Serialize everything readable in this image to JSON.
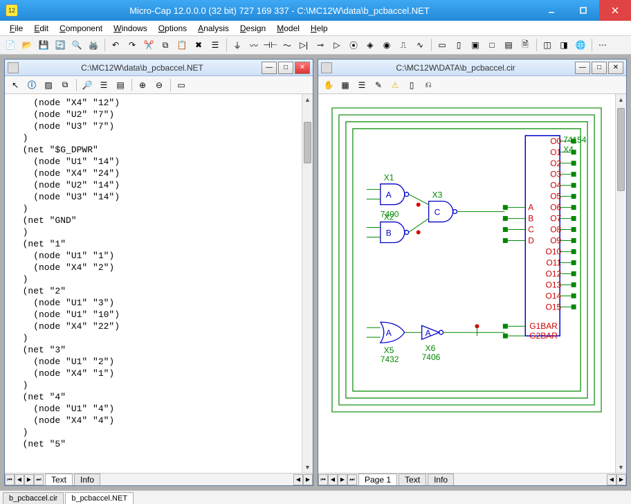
{
  "app": {
    "title": "Micro-Cap 12.0.0.0 (32 bit) 727 169 337 - C:\\MC12W\\data\\b_pcbaccel.NET",
    "icon_text": "12"
  },
  "menus": [
    "File",
    "Edit",
    "Component",
    "Windows",
    "Options",
    "Analysis",
    "Design",
    "Model",
    "Help"
  ],
  "bottom_tabs": [
    "b_pcbaccel.cir",
    "b_pcbaccel.NET"
  ],
  "left_panel": {
    "title": "C:\\MC12W\\data\\b_pcbaccel.NET",
    "tabs": [
      "Text",
      "Info"
    ],
    "content": "    (node \"X4\" \"12\")\n    (node \"U2\" \"7\")\n    (node \"U3\" \"7\")\n  )\n  (net \"$G_DPWR\"\n    (node \"U1\" \"14\")\n    (node \"X4\" \"24\")\n    (node \"U2\" \"14\")\n    (node \"U3\" \"14\")\n  )\n  (net \"GND\"\n  )\n  (net \"1\"\n    (node \"U1\" \"1\")\n    (node \"X4\" \"2\")\n  )\n  (net \"2\"\n    (node \"U1\" \"3\")\n    (node \"U1\" \"10\")\n    (node \"X4\" \"22\")\n  )\n  (net \"3\"\n    (node \"U1\" \"2\")\n    (node \"X4\" \"1\")\n  )\n  (net \"4\"\n    (node \"U1\" \"4\")\n    (node \"X4\" \"4\")\n  )\n  (net \"5\""
  },
  "right_panel": {
    "title": "C:\\MC12W\\DATA\\b_pcbaccel.cir",
    "tabs": [
      "Page 1",
      "Text",
      "Info"
    ],
    "components": {
      "x1": {
        "label": "X1",
        "port": "A",
        "part": "7400"
      },
      "x2": {
        "label": "X2",
        "port": "B"
      },
      "x3": {
        "label": "X3",
        "port": "C"
      },
      "x4": {
        "label": "74154",
        "ref": "X4"
      },
      "x5": {
        "label": "X5",
        "port": "A",
        "part": "7432"
      },
      "x6": {
        "label": "X6",
        "port": "A",
        "part": "7406"
      },
      "decoder_inputs": [
        "A",
        "B",
        "C",
        "D"
      ],
      "decoder_outputs": [
        "O0",
        "O1",
        "O2",
        "O3",
        "O4",
        "O5",
        "O6",
        "O7",
        "O8",
        "O9",
        "O10",
        "O11",
        "O12",
        "O13",
        "O14",
        "O15"
      ],
      "enables": [
        "G1BAR",
        "G2BAR"
      ]
    }
  }
}
